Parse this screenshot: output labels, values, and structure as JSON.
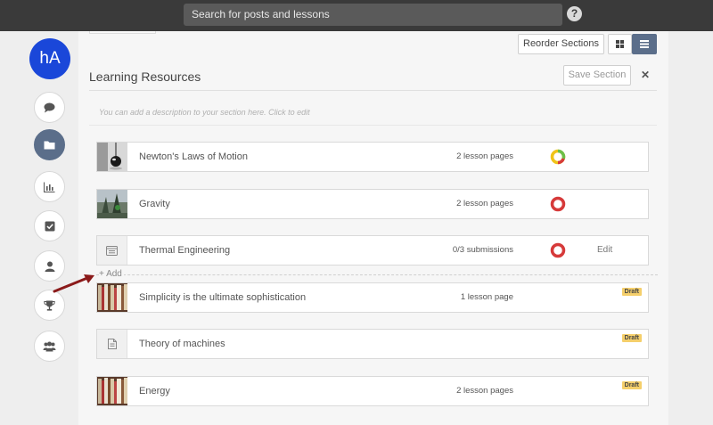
{
  "topbar": {
    "search_placeholder": "Search for posts and lessons",
    "help_label": "?"
  },
  "sidebar": {
    "avatar_initials": "hA",
    "items": [
      {
        "name": "messages",
        "icon": "comment-icon",
        "active": false
      },
      {
        "name": "resources",
        "icon": "folder-icon",
        "active": true
      },
      {
        "name": "reports",
        "icon": "bar-chart-icon",
        "active": false
      },
      {
        "name": "tasks",
        "icon": "checkbox-icon",
        "active": false
      },
      {
        "name": "profile",
        "icon": "user-icon",
        "active": false
      },
      {
        "name": "achievements",
        "icon": "trophy-icon",
        "active": false
      },
      {
        "name": "groups",
        "icon": "users-icon",
        "active": false
      }
    ]
  },
  "toolbar": {
    "reorder_label": "Reorder Sections",
    "grid_icon": "grid-icon",
    "list_icon": "list-icon"
  },
  "section": {
    "title": "Learning Resources",
    "save_label": "Save Section",
    "close_label": "✕",
    "description_placeholder": "You can add a description to your section here. Click to edit",
    "add_label": "+ Add"
  },
  "lessons": [
    {
      "title": "Newton's Laws of Motion",
      "count": "2 lesson pages",
      "status": "in-progress",
      "thumb": "pendulum"
    },
    {
      "title": "Gravity",
      "count": "2 lesson pages",
      "status": "not-started",
      "thumb": "tree"
    },
    {
      "title": "Thermal Engineering",
      "count": "0/3 submissions",
      "status": "not-started",
      "thumb": "assignment-icon",
      "edit_label": "Edit"
    },
    {
      "title": "Simplicity is the ultimate sophistication",
      "count": "1 lesson page",
      "draft_label": "Draft",
      "thumb": "books"
    },
    {
      "title": "Theory of machines",
      "count": "",
      "draft_label": "Draft",
      "thumb": "document-icon"
    },
    {
      "title": "Energy",
      "count": "2 lesson pages",
      "draft_label": "Draft",
      "thumb": "books"
    }
  ],
  "colors": {
    "accent": "#5b6e8a",
    "avatar": "#1a47d9",
    "status_red": "#d63a3a",
    "status_green": "#6cc04a",
    "status_yellow": "#f0c419",
    "draft": "#f5cf6b",
    "arrow": "#8b1a1a"
  }
}
